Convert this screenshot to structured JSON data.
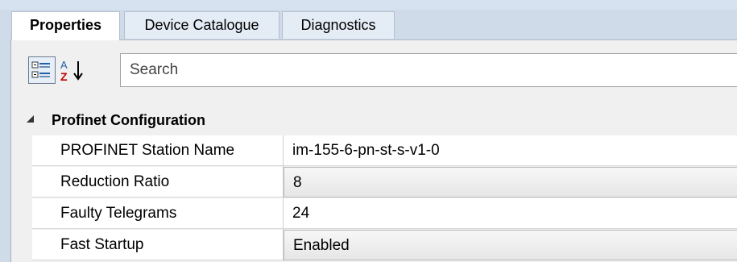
{
  "tabs": [
    {
      "label": "Properties",
      "active": true
    },
    {
      "label": "Device Catalogue",
      "active": false
    },
    {
      "label": "Diagnostics",
      "active": false
    }
  ],
  "toolbar": {
    "categorized_icon": "categorized-view-icon",
    "alphabetical_icon": "sort-alphabetical-icon",
    "search_placeholder": "Search",
    "search_value": ""
  },
  "category": {
    "label": "Profinet Configuration",
    "expanded": true,
    "expander_icon": "collapse-triangle-icon"
  },
  "properties": [
    {
      "name": "PROFINET Station Name",
      "value": "im-155-6-pn-st-s-v1-0",
      "editor": "text"
    },
    {
      "name": "Reduction Ratio",
      "value": "8",
      "editor": "dropdown"
    },
    {
      "name": "Faulty Telegrams",
      "value": "24",
      "editor": "text"
    },
    {
      "name": "Fast Startup",
      "value": "Enabled",
      "editor": "dropdown"
    }
  ],
  "colors": {
    "frame_background": "#cfdbe9",
    "panel_background": "#f0f0f0",
    "active_tab": "#ffffff",
    "inactive_tab": "#e4ecf5"
  }
}
